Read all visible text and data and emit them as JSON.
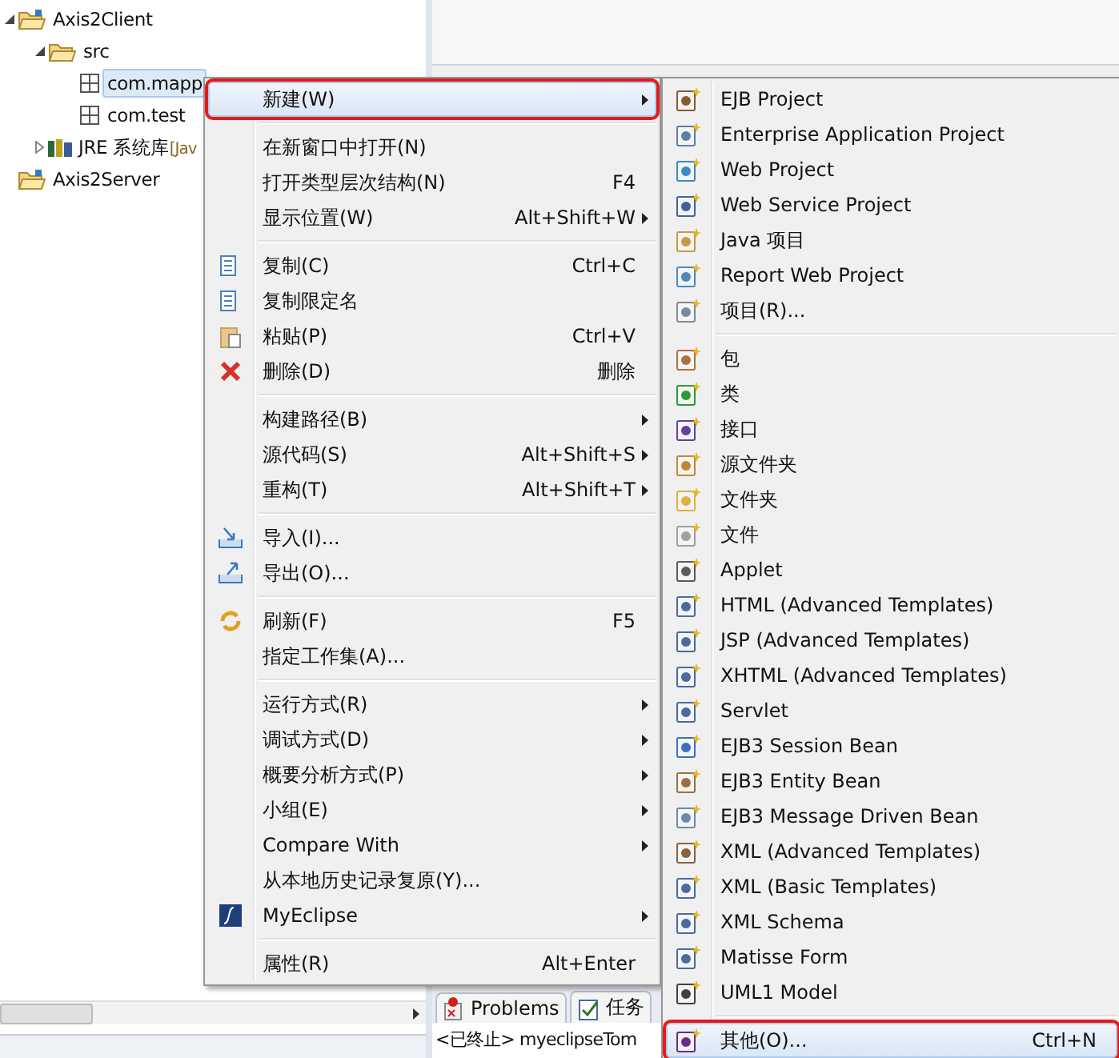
{
  "tree": [
    {
      "label": "Axis2Client",
      "kind": "project",
      "expanded": true,
      "selected": false,
      "children": [
        {
          "label": "src",
          "kind": "folder",
          "expanded": true,
          "selected": false,
          "children": [
            {
              "label": "com.mapp",
              "kind": "package",
              "selected": true
            },
            {
              "label": "com.test",
              "kind": "package",
              "selected": false
            }
          ]
        },
        {
          "label": "JRE 系统库",
          "decoration": "[Jav",
          "kind": "library",
          "expanded": false,
          "selected": false
        }
      ]
    },
    {
      "label": "Axis2Server",
      "kind": "project",
      "selected": false
    }
  ],
  "bottom_tabs": [
    {
      "label": "Problems",
      "selected": false
    },
    {
      "label": "任务",
      "selected": false
    }
  ],
  "console_text": "<已终止> myeclipseTom",
  "context_menu": {
    "sections": [
      [
        {
          "label": "新建(W)",
          "submenu": true,
          "selected": true,
          "annotated": true
        }
      ],
      [
        {
          "label": "在新窗口中打开(N)",
          "selected": false
        },
        {
          "label": "打开类型层次结构(N)",
          "shortcut": "F4",
          "selected": false
        },
        {
          "label": "显示位置(W)",
          "shortcut": "Alt+Shift+W",
          "submenu": true,
          "selected": false
        }
      ],
      [
        {
          "label": "复制(C)",
          "shortcut": "Ctrl+C",
          "selected": false
        },
        {
          "label": "复制限定名",
          "selected": false
        },
        {
          "label": "粘贴(P)",
          "shortcut": "Ctrl+V",
          "selected": false
        },
        {
          "label": "删除(D)",
          "shortcut": "删除",
          "selected": false
        }
      ],
      [
        {
          "label": "构建路径(B)",
          "submenu": true,
          "selected": false
        },
        {
          "label": "源代码(S)",
          "shortcut": "Alt+Shift+S",
          "submenu": true,
          "selected": false
        },
        {
          "label": "重构(T)",
          "shortcut": "Alt+Shift+T",
          "submenu": true,
          "selected": false
        }
      ],
      [
        {
          "label": "导入(I)...",
          "selected": false
        },
        {
          "label": "导出(O)...",
          "selected": false
        }
      ],
      [
        {
          "label": "刷新(F)",
          "shortcut": "F5",
          "selected": false
        },
        {
          "label": "指定工作集(A)...",
          "selected": false
        }
      ],
      [
        {
          "label": "运行方式(R)",
          "submenu": true,
          "selected": false
        },
        {
          "label": "调试方式(D)",
          "submenu": true,
          "selected": false
        },
        {
          "label": "概要分析方式(P)",
          "submenu": true,
          "selected": false
        },
        {
          "label": "小组(E)",
          "submenu": true,
          "selected": false
        },
        {
          "label": "Compare With",
          "submenu": true,
          "selected": false
        },
        {
          "label": "从本地历史记录复原(Y)...",
          "selected": false
        },
        {
          "label": "MyEclipse",
          "submenu": true,
          "selected": false
        }
      ],
      [
        {
          "label": "属性(R)",
          "shortcut": "Alt+Enter",
          "selected": false
        }
      ]
    ]
  },
  "new_submenu": {
    "sections": [
      [
        {
          "label": "EJB Project",
          "selected": false
        },
        {
          "label": "Enterprise Application Project",
          "selected": false
        },
        {
          "label": "Web Project",
          "selected": false
        },
        {
          "label": "Web Service Project",
          "selected": false
        },
        {
          "label": "Java 项目",
          "selected": false
        },
        {
          "label": "Report Web Project",
          "selected": false
        },
        {
          "label": "项目(R)...",
          "selected": false
        }
      ],
      [
        {
          "label": "包",
          "selected": false
        },
        {
          "label": "类",
          "selected": false
        },
        {
          "label": "接口",
          "selected": false
        },
        {
          "label": "源文件夹",
          "selected": false
        },
        {
          "label": "文件夹",
          "selected": false
        },
        {
          "label": "文件",
          "selected": false
        },
        {
          "label": "Applet",
          "selected": false
        },
        {
          "label": "HTML (Advanced Templates)",
          "selected": false
        },
        {
          "label": "JSP (Advanced Templates)",
          "selected": false
        },
        {
          "label": "XHTML (Advanced Templates)",
          "selected": false
        },
        {
          "label": "Servlet",
          "selected": false
        },
        {
          "label": "EJB3 Session Bean",
          "selected": false
        },
        {
          "label": "EJB3 Entity Bean",
          "selected": false
        },
        {
          "label": "EJB3 Message Driven Bean",
          "selected": false
        },
        {
          "label": "XML (Advanced Templates)",
          "selected": false
        },
        {
          "label": "XML (Basic Templates)",
          "selected": false
        },
        {
          "label": "XML Schema",
          "selected": false
        },
        {
          "label": "Matisse Form",
          "selected": false
        },
        {
          "label": "UML1 Model",
          "selected": false
        }
      ],
      [
        {
          "label": "其他(O)...",
          "shortcut": "Ctrl+N",
          "selected": true,
          "annotated": true
        }
      ]
    ]
  }
}
